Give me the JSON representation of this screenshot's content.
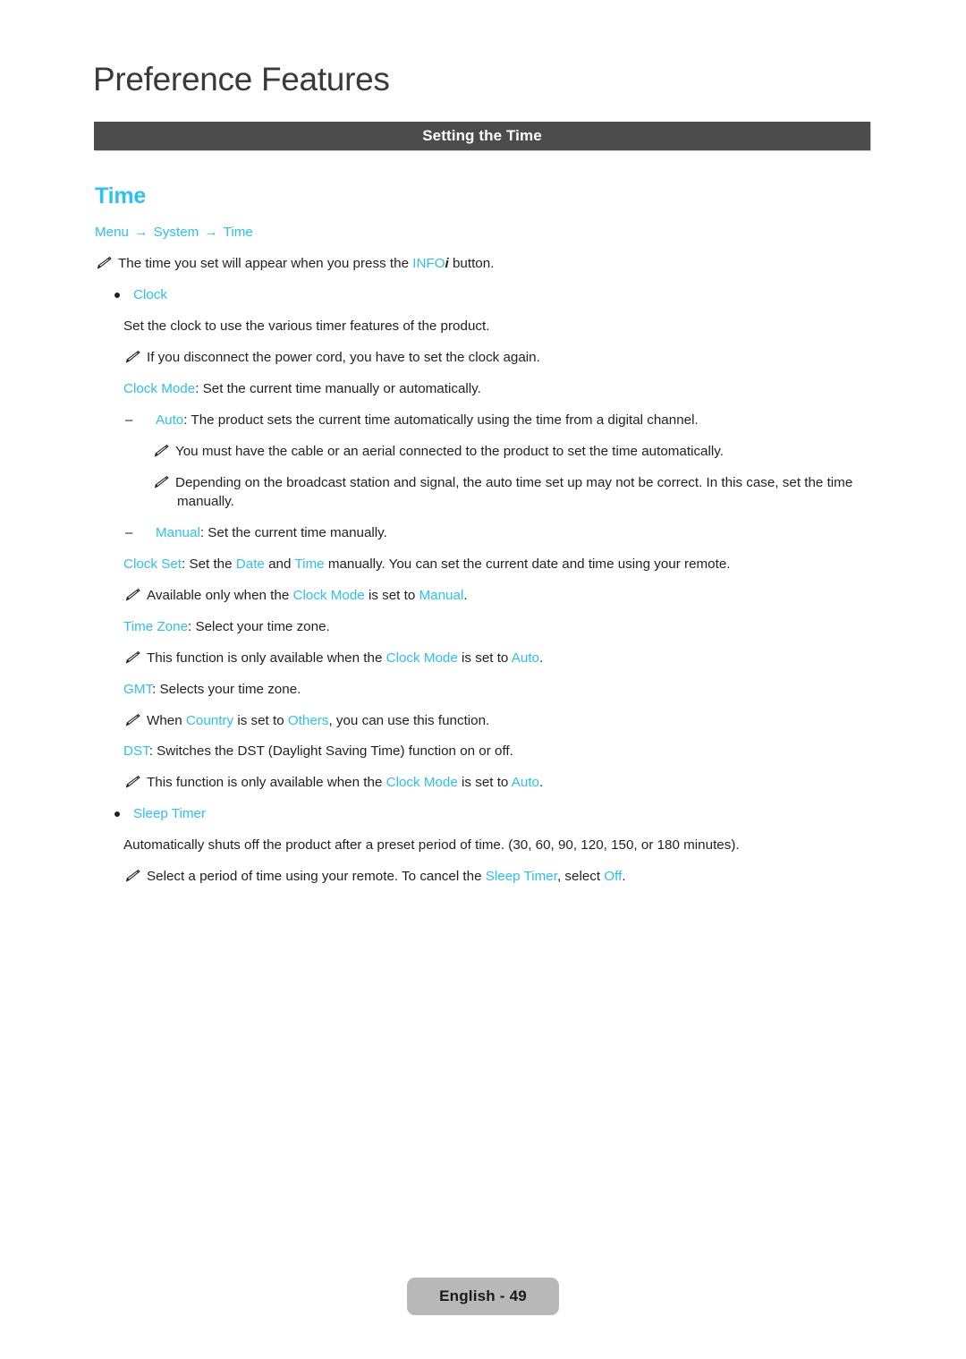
{
  "page": {
    "chapter_title": "Preference Features",
    "section_bar_label": "Setting the Time",
    "main_heading": "Time",
    "footer_label": "English - 49"
  },
  "colors": {
    "accent_cyan": "#29c2f2",
    "section_bar_bg": "#4c4c4c",
    "body_text": "#231f20",
    "footer_pill_bg": "#b8b8b8"
  },
  "breadcrumb": {
    "items": [
      "Menu",
      "System",
      "Time"
    ],
    "separator": "→"
  },
  "icons": {
    "note": "pencil-note-icon",
    "bullet": "bullet-dot-icon",
    "dash": "–"
  },
  "content": {
    "note_intro": {
      "pre": "The time you set will appear when you press the ",
      "key": "INFO",
      "key_suffix": "i",
      "post": " button."
    },
    "clock": {
      "bullet_label": "Clock",
      "intro": "Set the clock to use the various timer features of the product.",
      "note_power_cord": "If you disconnect the power cord, you have to set the clock again.",
      "clock_mode": {
        "key": "Clock Mode",
        "text": ": Set the current time manually or automatically."
      },
      "auto": {
        "key": "Auto",
        "text": ": The product sets the current time automatically using the time from a digital channel.",
        "note_cable": "You must have the cable or an aerial connected to the product to set the time automatically.",
        "note_broadcast": "Depending on the broadcast station and signal, the auto time set up may not be correct. In this case, set the time manually."
      },
      "manual": {
        "key": "Manual",
        "text": ": Set the current time manually."
      },
      "clock_set": {
        "key": "Clock Set",
        "seg1": ": Set the ",
        "key2": "Date",
        "seg2": " and ",
        "key3": "Time",
        "seg3": " manually. You can set the current date and time using your remote.",
        "note_pre": "Available only when the ",
        "note_key1": "Clock Mode",
        "note_mid": " is set to ",
        "note_key2": "Manual",
        "note_post": "."
      },
      "time_zone": {
        "key": "Time Zone",
        "text": ": Select your time zone.",
        "note_pre": "This function is only available when the ",
        "note_key1": "Clock Mode",
        "note_mid": " is set to ",
        "note_key2": "Auto",
        "note_post": "."
      },
      "gmt": {
        "key": "GMT",
        "text": ": Selects your time zone.",
        "note_pre": "When ",
        "note_key1": "Country",
        "note_mid": " is set to ",
        "note_key2": "Others",
        "note_post": ", you can use this function."
      },
      "dst": {
        "key": "DST",
        "text": ": Switches the DST (Daylight Saving Time) function on or off.",
        "note_pre": "This function is only available when the ",
        "note_key1": "Clock Mode",
        "note_mid": " is set to ",
        "note_key2": "Auto",
        "note_post": "."
      }
    },
    "sleep_timer": {
      "bullet_label": "Sleep Timer",
      "description": "Automatically shuts off the product after a preset period of time. (30, 60, 90, 120, 150, or 180 minutes).",
      "note_pre": "Select a period of time using your remote. To cancel the ",
      "note_key1": "Sleep Timer",
      "note_mid": ", select ",
      "note_key2": "Off",
      "note_post": "."
    }
  }
}
